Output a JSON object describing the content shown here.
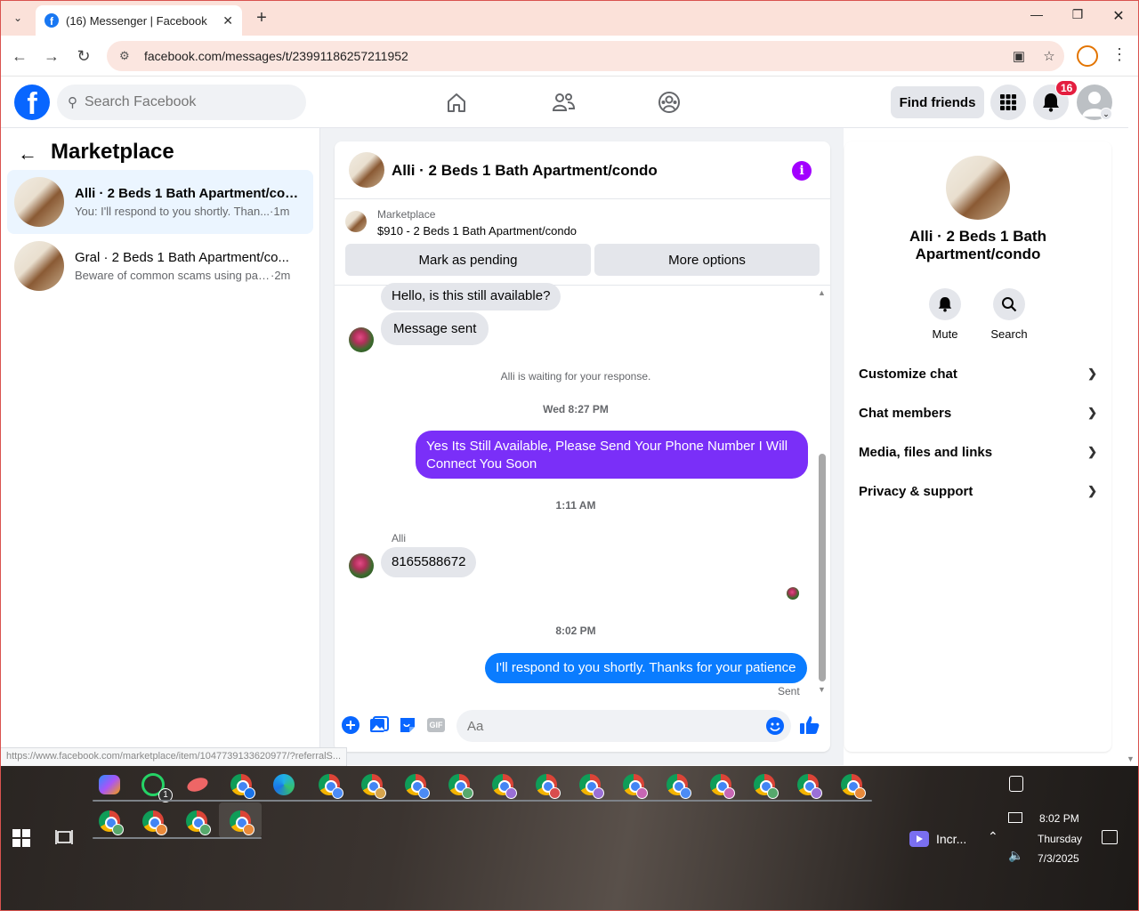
{
  "browser": {
    "tab_title": "(16) Messenger | Facebook",
    "url": "facebook.com/messages/t/23991186257211952",
    "status_url": "https://www.facebook.com/marketplace/item/1047739133620977/?referralS..."
  },
  "header": {
    "search_placeholder": "Search Facebook",
    "find_friends": "Find friends",
    "notification_count": "16"
  },
  "left": {
    "title": "Marketplace",
    "conversations": [
      {
        "name": "Alli · 2 Beds 1 Bath Apartment/con...",
        "preview": "You: I'll respond to you shortly. Than...",
        "time": "·1m"
      },
      {
        "name": "Gral · 2 Beds 1 Bath Apartment/co...",
        "preview": "Beware of common scams using pay...",
        "time": "·2m"
      }
    ]
  },
  "chat": {
    "title": "Alli · 2 Beds 1 Bath Apartment/condo",
    "marketplace_label": "Marketplace",
    "item": "$910 - 2 Beds 1 Bath Apartment/condo",
    "mark_pending": "Mark as pending",
    "more_options": "More options",
    "messages": {
      "m1": "Hello, is this still available?",
      "m2": "Message sent",
      "system": "Alli is waiting for your response.",
      "t1": "Wed 8:27 PM",
      "m3": "Yes Its Still Available, Please Send Your Phone Number I Will Connect You Soon",
      "t2": "1:11 AM",
      "sender": "Alli",
      "m4": "8165588672",
      "t3": "8:02 PM",
      "m5": "I'll respond to you shortly. Thanks for your patience",
      "sent": "Sent"
    },
    "composer_placeholder": "Aa",
    "gif_label": "GIF"
  },
  "right": {
    "name": "Alli · 2 Beds 1 Bath Apartment/condo",
    "mute": "Mute",
    "search": "Search",
    "sections": [
      "Customize chat",
      "Chat members",
      "Media, files and links",
      "Privacy & support"
    ]
  },
  "taskbar": {
    "app_label": "Incr...",
    "time": "8:02 PM",
    "day": "Thursday",
    "date": "7/3/2025",
    "whatsapp_badge": "1"
  },
  "colors": {
    "fb_blue": "#0866ff",
    "purple_bubble": "#7a2ff8",
    "blue_bubble": "#0a7cff",
    "info_purple": "#a200ff"
  }
}
